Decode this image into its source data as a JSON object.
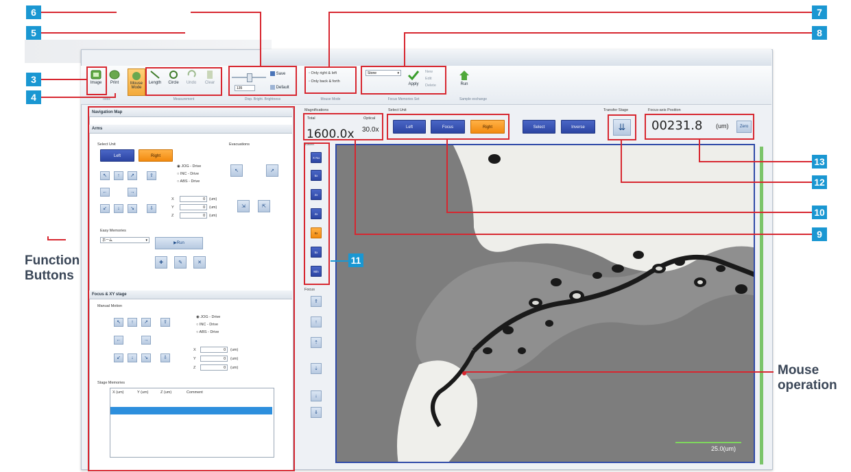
{
  "callouts": [
    "6",
    "5",
    "7",
    "8",
    "3",
    "4",
    "13",
    "12",
    "10",
    "9",
    "11"
  ],
  "annotations": {
    "function_buttons_line1": "Function",
    "function_buttons_line2": "Buttons",
    "mouse_operation_line1": "Mouse",
    "mouse_operation_line2": "operation"
  },
  "ribbon": {
    "image_btn": "Image",
    "print_btn": "Print",
    "mouse_mode_btn": "Mouse Mode",
    "length_btn": "Length",
    "circle_btn": "Circle",
    "undo_btn": "Undo",
    "clear_btn": "Clear",
    "save_btn": "Save",
    "default_btn": "Default",
    "brightness_value": "135",
    "only_right_left": "Only right & left",
    "only_back_forth": "Only back & forth",
    "memory_select": "Stone",
    "apply_btn": "Apply",
    "new_btn": "New",
    "edit_btn": "Edit",
    "delete_btn": "Delete",
    "run_btn": "Run",
    "groups": [
      "Tools",
      "Measurement",
      "Disp. Bright. Brightness",
      "Mouse Mode",
      "Focus Memories Set",
      "Sample exchange"
    ]
  },
  "left_panel": {
    "nav_map_title": "Navigation Map",
    "arms_title": "Arms",
    "select_unit_label": "Select Unit",
    "left_btn": "Left",
    "right_btn": "Right",
    "evacuations_label": "Evacuations",
    "drive_options": [
      "JOG - Drive",
      "INC - Drive",
      "ABS - Drive"
    ],
    "x_label": "X",
    "y_label": "Y",
    "z_label": "Z",
    "unit": "(um)",
    "field_value": "0",
    "easy_memories_label": "Easy Memories",
    "memory_select": "ホーム",
    "run_btn": "Run",
    "focus_title": "Focus & XY stage",
    "manual_motion_label": "Manual Motion",
    "stage_memories_label": "Stage Memories",
    "table_headers": [
      "X (um)",
      "Y (um)",
      "Z (um)",
      "Comment"
    ]
  },
  "magnification": {
    "label": "Magnifications",
    "total_label": "Total",
    "total_value": "1600.0x",
    "optical_label": "Optical",
    "optical_value": "30.0x"
  },
  "select_unit": {
    "label": "Select Unit",
    "left_btn": "Left",
    "focus_btn": "Focus",
    "right_btn": "Right",
    "select_btn": "Select",
    "inverse_btn": "Inverse"
  },
  "transfer_stage_label": "Transfer Stage",
  "focus_axis": {
    "label": "Focus-axis Position",
    "value": "00231.8",
    "unit": "(um)",
    "zero_btn": "Zero"
  },
  "zoom": {
    "label": "Zoom",
    "buttons": [
      "X Nu",
      "5x",
      "2x",
      "4x",
      "8x",
      "5x",
      "Min"
    ]
  },
  "focus_label": "Focus",
  "scale_bar_label": "25.0(um)",
  "colors": {
    "callout_blue": "#1a97d2",
    "highlight_red": "#d7262f",
    "button_blue": "#2c45a3",
    "button_orange": "#f28a0f",
    "focus_green": "#7bc46a"
  }
}
